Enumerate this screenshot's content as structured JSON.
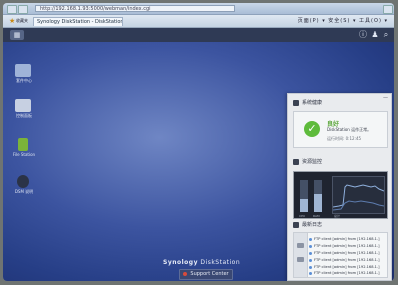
{
  "browser": {
    "url": "http://192.168.1.93:5000/webman/index.cgi",
    "tab_title": "Synology DiskStation - DiskStation",
    "favorites_label": "收藏夹",
    "tools_label": "页面(P) ▾ 安全(S) ▾ 工具(O) ▾"
  },
  "dsm": {
    "home_icon": "grid-icon",
    "top_icons": [
      "info-icon",
      "user-icon",
      "search-icon"
    ]
  },
  "desktop": {
    "icons": [
      {
        "name": "package-center-icon",
        "label": "套件中心",
        "color": "#9fb3d8"
      },
      {
        "name": "control-panel-icon",
        "label": "控制面板",
        "color": "#c7d0e2"
      },
      {
        "name": "file-station-icon",
        "label": "File Station",
        "color": "#7bb33a"
      },
      {
        "name": "dsm-help-icon",
        "label": "DSM 说明",
        "color": "#2b3347"
      }
    ],
    "brand_bold": "Synology",
    "brand_rest": " DiskStation",
    "support_button": "Support Center"
  },
  "panel": {
    "close": "—",
    "health": {
      "title": "系统健康",
      "status": "良好",
      "description": "DiskStation 运作正常。",
      "uptime": "运行时间: 0:12:45"
    },
    "monitor": {
      "title": "资源监控",
      "cpu_label": "CPU",
      "ram_label": "RAM",
      "net_label": "总计",
      "cpu_percent": 40,
      "ram_percent": 55
    },
    "logs": {
      "title": "最新日志",
      "rows": [
        "FTP client [admin] from [192.168.1.]",
        "FTP client [admin] from [192.168.1.]",
        "FTP client [admin] from [192.168.1.]",
        "FTP client [admin] from [192.168.1.]",
        "FTP client [admin] from [192.168.1.]",
        "FTP client [admin] from [192.168.1.]"
      ]
    }
  }
}
